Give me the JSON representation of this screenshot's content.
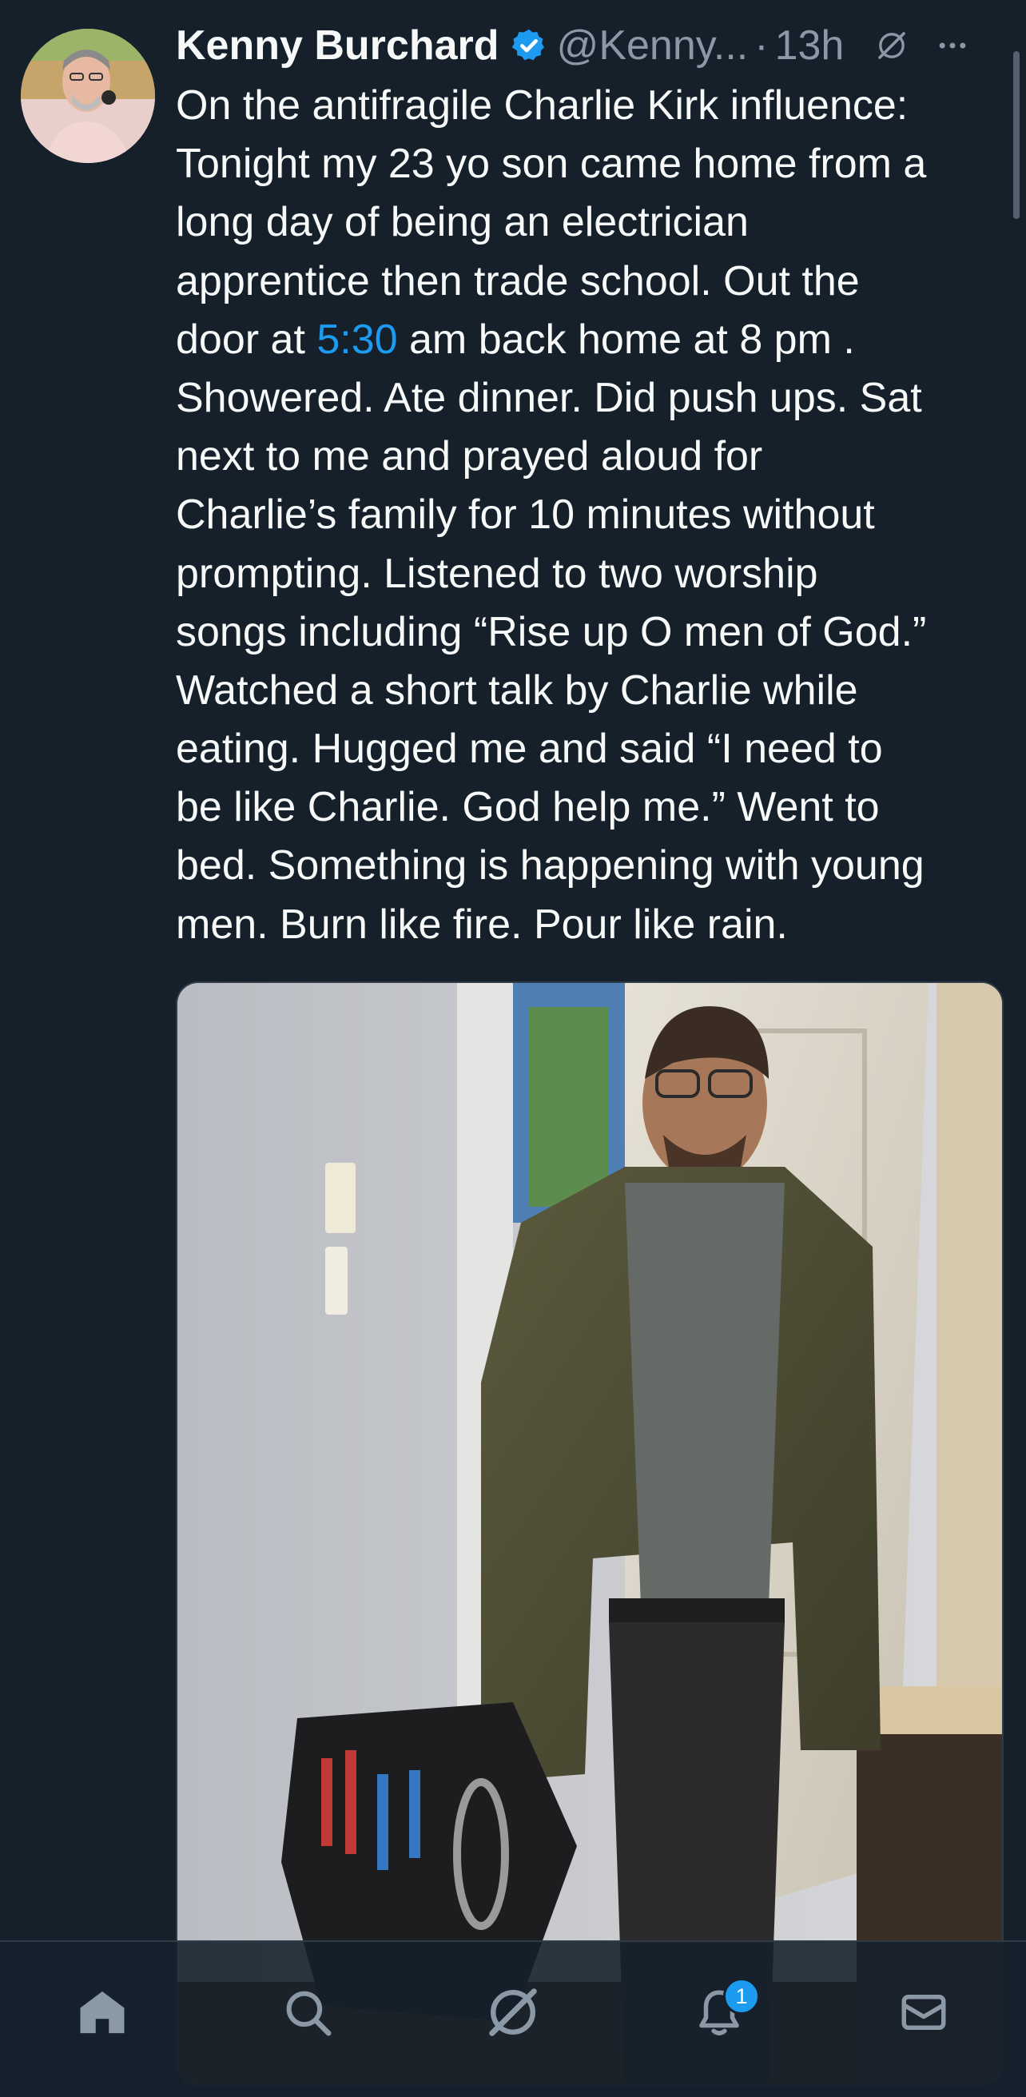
{
  "post": {
    "author_name": "Kenny Burchard",
    "handle": "@Kenny...",
    "separator": "·",
    "time_ago": "13h",
    "text_lines": [
      {
        "before": "On the antifragile Charlie Kirk influence:",
        "link": "",
        "after": ""
      },
      {
        "before": "Tonight my 23 yo son came home from a",
        "link": "",
        "after": ""
      },
      {
        "before": "long day of being an electrician",
        "link": "",
        "after": ""
      },
      {
        "before": "apprentice then trade school. Out the",
        "link": "",
        "after": ""
      },
      {
        "before": "door at ",
        "link": "5:30",
        "after": " am back home at 8 pm ."
      },
      {
        "before": "Showered. Ate dinner. Did push ups. Sat",
        "link": "",
        "after": ""
      },
      {
        "before": "next to me and prayed aloud for",
        "link": "",
        "after": ""
      },
      {
        "before": "Charlie’s family for 10 minutes without",
        "link": "",
        "after": ""
      },
      {
        "before": "prompting. Listened to two worship",
        "link": "",
        "after": ""
      },
      {
        "before": "songs including “Rise up O men of God.”",
        "link": "",
        "after": ""
      },
      {
        "before": "Watched a short talk by Charlie while",
        "link": "",
        "after": ""
      },
      {
        "before": "eating. Hugged me and said “I need to",
        "link": "",
        "after": ""
      },
      {
        "before": "be like Charlie. God help me.” Went to",
        "link": "",
        "after": ""
      },
      {
        "before": "bed. Something is happening with young",
        "link": "",
        "after": ""
      },
      {
        "before": "men. Burn like fire. Pour like rain.",
        "link": "",
        "after": ""
      }
    ],
    "icons": {
      "verified": "verified-badge-icon",
      "grok": "grok-icon",
      "more": "more-options-icon"
    }
  },
  "tab_bar": {
    "items": [
      {
        "name": "home",
        "icon": "home-icon"
      },
      {
        "name": "search",
        "icon": "search-icon"
      },
      {
        "name": "grok",
        "icon": "grok-icon"
      },
      {
        "name": "notifications",
        "icon": "bell-icon",
        "badge": "1"
      },
      {
        "name": "messages",
        "icon": "envelope-icon"
      }
    ]
  },
  "colors": {
    "background": "#15202b",
    "text": "#f7f9f9",
    "secondary_text": "#8b98a5",
    "accent": "#1d9bf0"
  }
}
